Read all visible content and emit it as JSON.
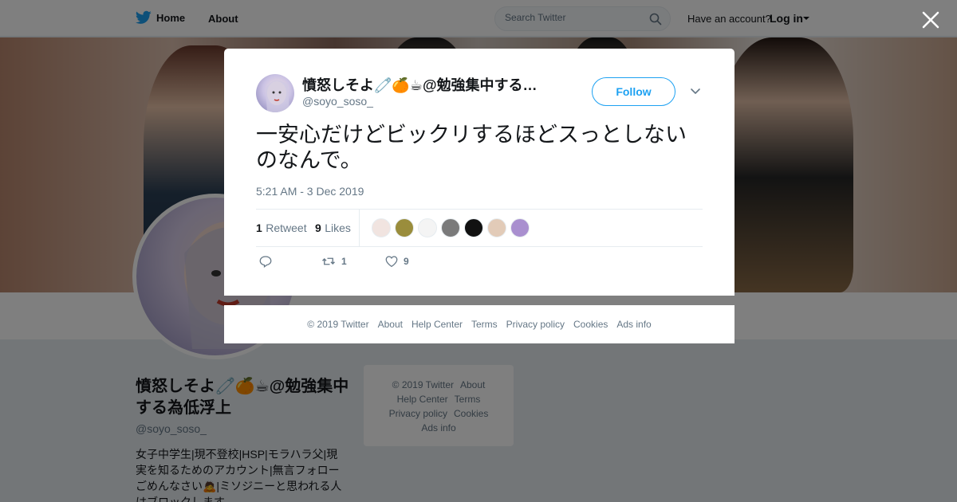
{
  "nav": {
    "home_label": "Home",
    "about_label": "About",
    "search_placeholder": "Search Twitter",
    "have_account": "Have an account?",
    "login_label": "Log in"
  },
  "profile": {
    "name": "憤怒しそよ🧷🍊☕@勉強集中する為低浮上",
    "handle": "@soyo_soso_",
    "bio": "女子中学生|現不登校|HSP|モラハラ父|現実を知るためのアカウント|無言フォローごめんなさい🙇|ミソジニーと思われる人はブロックします"
  },
  "side_footer": {
    "copyright": "© 2019 Twitter",
    "about": "About",
    "help": "Help Center",
    "terms": "Terms",
    "privacy": "Privacy policy",
    "cookies": "Cookies",
    "ads": "Ads info"
  },
  "tweet": {
    "author_name": "憤怒しそよ🧷🍊☕@勉強集中する…",
    "author_handle": "@soyo_soso_",
    "follow_label": "Follow",
    "text": "一安心だけどビックリするほどスっとしないのなんで。",
    "timestamp": "5:21 AM - 3 Dec 2019",
    "retweet_count": "1",
    "retweet_label": "Retweet",
    "like_count": "9",
    "like_label": "Likes",
    "action_retweet_count": "1",
    "action_like_count": "9"
  },
  "likers": [
    {
      "color": "#f1e4e0",
      "name": "liker-1"
    },
    {
      "color": "#9a8d3c",
      "name": "liker-2"
    },
    {
      "color": "#f4f4f4",
      "name": "liker-3"
    },
    {
      "color": "#7a7a7a",
      "name": "liker-4"
    },
    {
      "color": "#111111",
      "name": "liker-5"
    },
    {
      "color": "#e2cbb8",
      "name": "liker-6"
    },
    {
      "color": "#a98fcf",
      "name": "liker-7"
    }
  ],
  "modal_footer": {
    "copyright": "© 2019 Twitter",
    "about": "About",
    "help": "Help Center",
    "terms": "Terms",
    "privacy": "Privacy policy",
    "cookies": "Cookies",
    "ads": "Ads info"
  },
  "colors": {
    "accent": "#1da1f2",
    "muted": "#657786",
    "text": "#14171a"
  }
}
